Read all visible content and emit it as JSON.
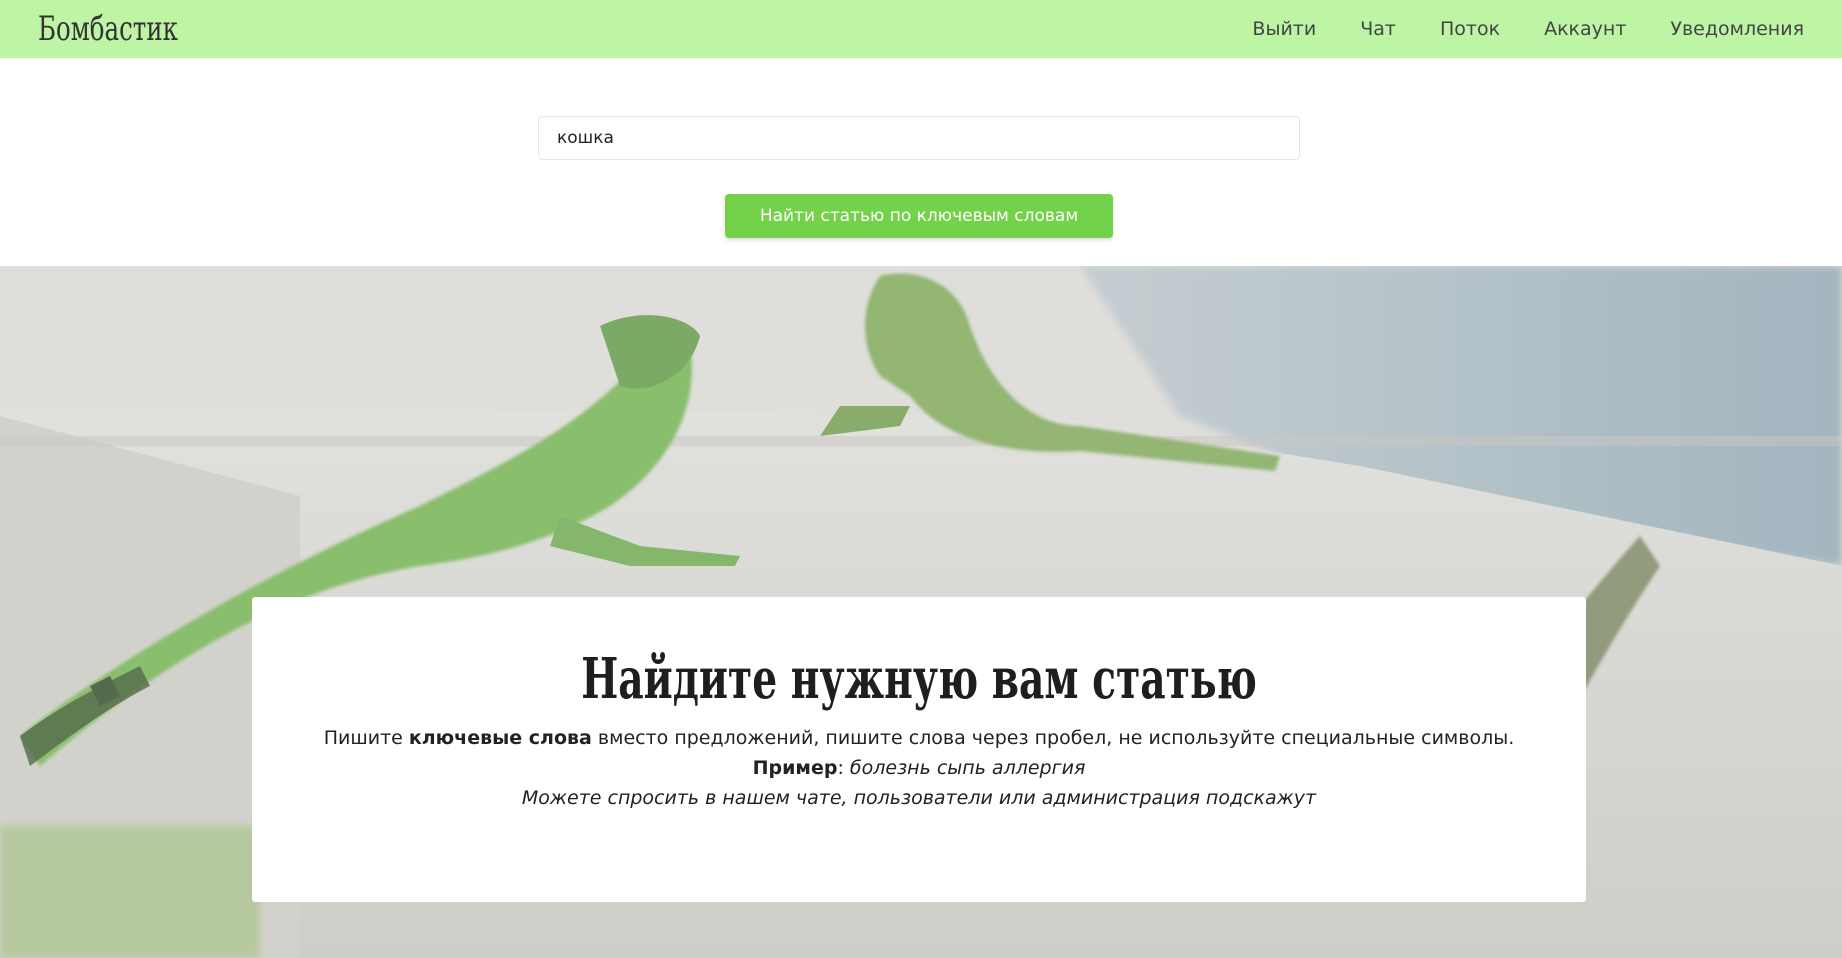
{
  "brand": "Бомбастик",
  "nav": {
    "items": [
      "Выйти",
      "Чат",
      "Поток",
      "Аккаунт",
      "Уведомления"
    ]
  },
  "search": {
    "value": "кошка",
    "button_label": "Найти статью по ключевым словам"
  },
  "card": {
    "title": "Найдите нужную вам статью",
    "line1_before": "Пишите ",
    "line1_bold": "ключевые слова",
    "line1_after": " вместо предложений, пишите слова через пробел, не используйте специальные символы.",
    "example_label": "Пример",
    "example_sep": ": ",
    "example_text": "болезнь сыпь аллергия",
    "line3": "Можете спросить в нашем чате, пользователи или администрация подскажут"
  },
  "colors": {
    "navbar_bg": "#bdf5a5",
    "button_bg": "#74d14a"
  }
}
